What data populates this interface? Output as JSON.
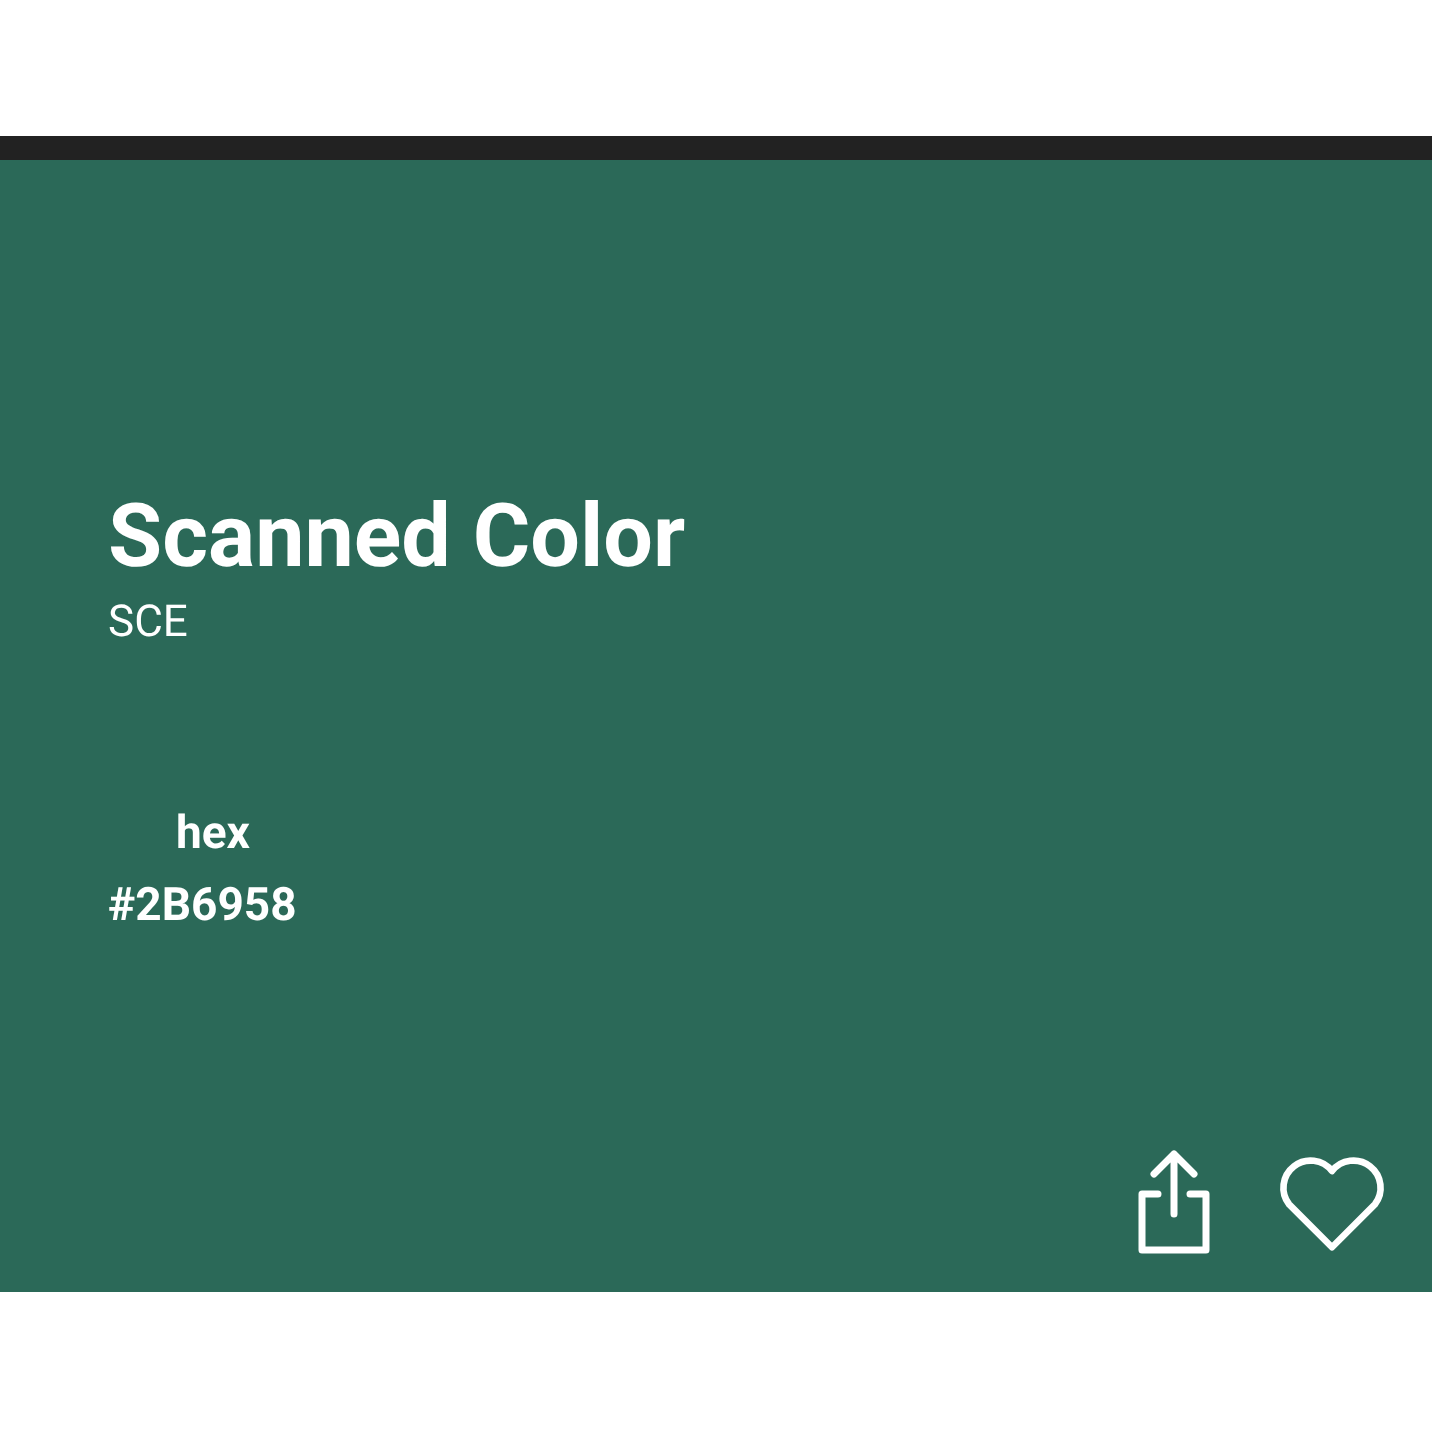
{
  "color_card": {
    "title": "Scanned Color",
    "subtitle": "SCE",
    "value_label": "hex",
    "value": "#2B6958"
  }
}
